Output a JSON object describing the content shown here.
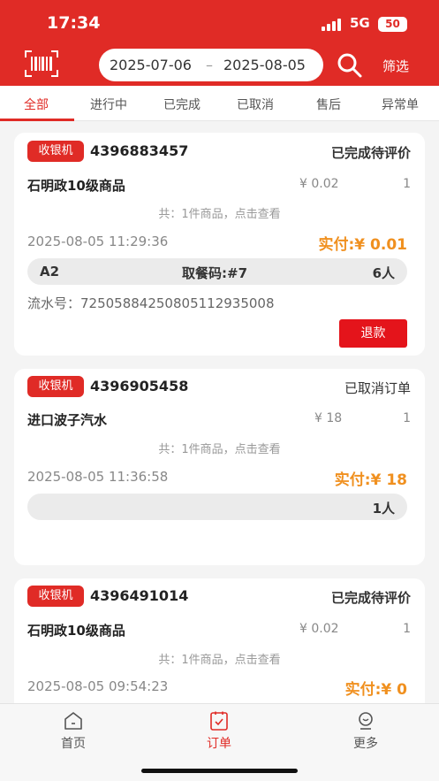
{
  "status_bar": {
    "time": "17:34",
    "network": "5G",
    "battery": "50"
  },
  "header": {
    "date_start": "2025-07-06",
    "date_separator": "–",
    "date_end": "2025-08-05",
    "filter_label": "筛选",
    "accent_color": "#e02b26"
  },
  "tabs": [
    {
      "label": "全部",
      "active": true
    },
    {
      "label": "进行中"
    },
    {
      "label": "已完成"
    },
    {
      "label": "已取消"
    },
    {
      "label": "售后"
    },
    {
      "label": "异常单"
    }
  ],
  "orders": [
    {
      "badge": "收银机",
      "order_no": "4396883457",
      "status": "已完成待评价",
      "product": "石明政10级商品",
      "price": "¥ 0.02",
      "qty": "1",
      "summary": "共：1件商品，点击查看",
      "time": "2025-08-05 11:29:36",
      "paid": "实付:¥ 0.01",
      "table": "A2",
      "pickup": "取餐码:#7",
      "people": "6人",
      "serial": "流水号：725058842508051129350​08",
      "action": "退款"
    },
    {
      "badge": "收银机",
      "order_no": "4396905458",
      "status": "已取消订单",
      "product": "进口波子汽水",
      "price": "¥ 18",
      "qty": "1",
      "summary": "共：1件商品，点击查看",
      "time": "2025-08-05 11:36:58",
      "paid": "实付:¥ 18",
      "people": "1人"
    },
    {
      "badge": "收银机",
      "order_no": "4396491014",
      "status": "已完成待评价",
      "product": "石明政10级商品",
      "price": "¥ 0.02",
      "qty": "1",
      "summary": "共：1件商品，点击查看",
      "time": "2025-08-05 09:54:23",
      "paid": "实付:¥ 0"
    }
  ],
  "bottom_nav": [
    {
      "label": "首页",
      "icon": "home-icon"
    },
    {
      "label": "订单",
      "icon": "order-icon",
      "active": true
    },
    {
      "label": "更多",
      "icon": "more-icon"
    }
  ]
}
